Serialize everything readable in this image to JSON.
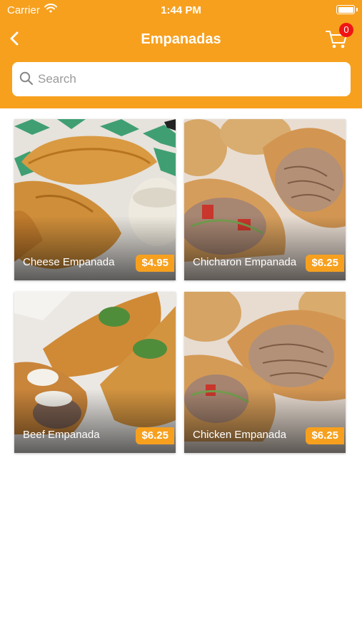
{
  "status_bar": {
    "carrier": "Carrier",
    "time": "1:44 PM"
  },
  "nav": {
    "title": "Empanadas",
    "cart_count": "0"
  },
  "search": {
    "placeholder": "Search",
    "value": ""
  },
  "colors": {
    "brand": "#F7A01E",
    "badge_red": "#F01414"
  },
  "icons": {
    "back": "chevron-left-icon",
    "cart": "shopping-cart-icon",
    "search": "magnifier-icon",
    "wifi": "wifi-icon",
    "battery": "battery-icon"
  },
  "products": [
    {
      "name": "Cheese Empanada",
      "price": "$4.95"
    },
    {
      "name": "Chicharon Empanada",
      "price": "$6.25"
    },
    {
      "name": "Beef Empanada",
      "price": "$6.25"
    },
    {
      "name": "Chicken Empanada",
      "price": "$6.25"
    }
  ]
}
